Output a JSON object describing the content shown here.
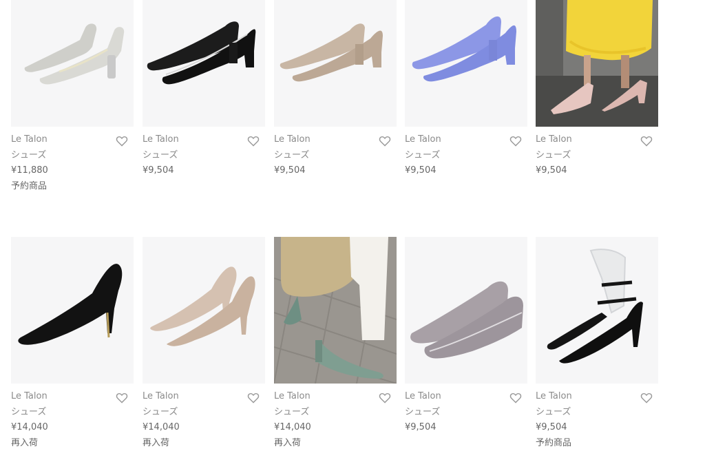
{
  "colors": {
    "text": "#6e6e6e",
    "thumb_bg": "#f6f6f7",
    "heart": "#9a9a9a"
  },
  "products": [
    {
      "brand": "Le Talon",
      "category": "シューズ",
      "price": "¥11,880",
      "tag": "予約商品",
      "icon": "heart-outline-icon",
      "image": "silver-metallic-pumps"
    },
    {
      "brand": "Le Talon",
      "category": "シューズ",
      "price": "¥9,504",
      "tag": "",
      "icon": "heart-outline-icon",
      "image": "black-suede-block-heel-pumps"
    },
    {
      "brand": "Le Talon",
      "category": "シューズ",
      "price": "¥9,504",
      "tag": "",
      "icon": "heart-outline-icon",
      "image": "taupe-suede-block-heel-pumps"
    },
    {
      "brand": "Le Talon",
      "category": "シューズ",
      "price": "¥9,504",
      "tag": "",
      "icon": "heart-outline-icon",
      "image": "periwinkle-suede-block-heel-pumps"
    },
    {
      "brand": "Le Talon",
      "category": "シューズ",
      "price": "¥9,504",
      "tag": "",
      "icon": "heart-outline-icon",
      "image": "model-yellow-lace-skirt-pink-pumps"
    },
    {
      "brand": "Le Talon",
      "category": "シューズ",
      "price": "¥14,040",
      "tag": "再入荷",
      "icon": "heart-outline-icon",
      "image": "black-suede-stiletto-pumps"
    },
    {
      "brand": "Le Talon",
      "category": "シューズ",
      "price": "¥14,040",
      "tag": "再入荷",
      "icon": "heart-outline-icon",
      "image": "beige-suede-stiletto-pumps"
    },
    {
      "brand": "Le Talon",
      "category": "シューズ",
      "price": "¥14,040",
      "tag": "再入荷",
      "icon": "heart-outline-icon",
      "image": "model-green-pumps-street"
    },
    {
      "brand": "Le Talon",
      "category": "シューズ",
      "price": "¥9,504",
      "tag": "",
      "icon": "heart-outline-icon",
      "image": "grey-suede-wedge-pumps"
    },
    {
      "brand": "Le Talon",
      "category": "シューズ",
      "price": "¥9,504",
      "tag": "予約商品",
      "icon": "heart-outline-icon",
      "image": "black-ankle-strap-clear-heels"
    }
  ]
}
